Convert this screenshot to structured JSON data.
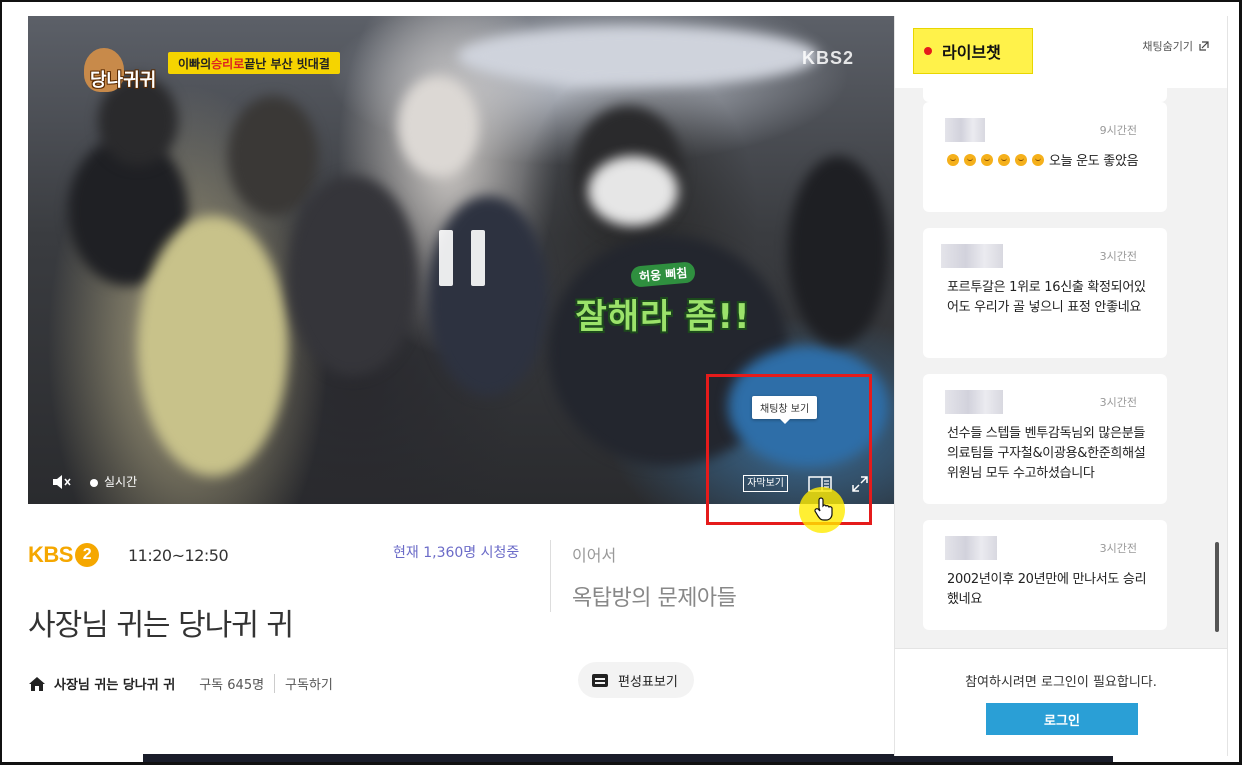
{
  "video": {
    "show_title_badge": "당나귀귀",
    "banner_pre": "이빠의 ",
    "banner_red": "승리로",
    "banner_post": " 끝난 부산 빗대결",
    "channel_watermark": "KBS2",
    "caption_small": "허웅 삐침",
    "caption_big": "잘해라 좀!!",
    "live_label": "실시간",
    "subtitle_button": "자막보기",
    "tooltip": "채팅창 보기"
  },
  "info": {
    "channel_logo_text": "KBS",
    "channel_logo_num": "2",
    "time_range": "11:20~12:50",
    "viewers": "현재 1,360명 시청중",
    "next_label": "이어서",
    "next_title": "옥탑방의 문제아들",
    "program_title": "사장님 귀는 당나귀 귀",
    "home_name": "사장님 귀는 당나귀 귀",
    "subscriber_count": "구독 645명",
    "subscribe_label": "구독하기",
    "schedule_label": "편성표보기"
  },
  "chat": {
    "title": "라이브챗",
    "hide_label": "채팅숨기기",
    "messages": [
      {
        "ago": "9시간전",
        "text": "오늘 운도 좋았음",
        "emoji_count": 6
      },
      {
        "ago": "3시간전",
        "text": "포르투갈은 1위로 16신출 확정되어있어도 우리가 골 넣으니 표정 안좋네요"
      },
      {
        "ago": "3시간전",
        "text": "선수들 스텝들 벤투감독님외 많은분들 의료팀들 구자철&이광용&한준희해설위원님 모두 수고하셨습니다"
      },
      {
        "ago": "3시간전",
        "text": "2002년이후 20년만에 만나서도 승리했네요"
      }
    ],
    "login_required": "참여하시려면 로그인이 필요합니다.",
    "login_button": "로그인"
  },
  "colors": {
    "accent_blue": "#2a9fd6",
    "highlight_yellow": "#fff24a",
    "annotation_red": "#e51b1b",
    "kbs_orange": "#f5a700",
    "viewer_purple": "#6b6bc8"
  }
}
